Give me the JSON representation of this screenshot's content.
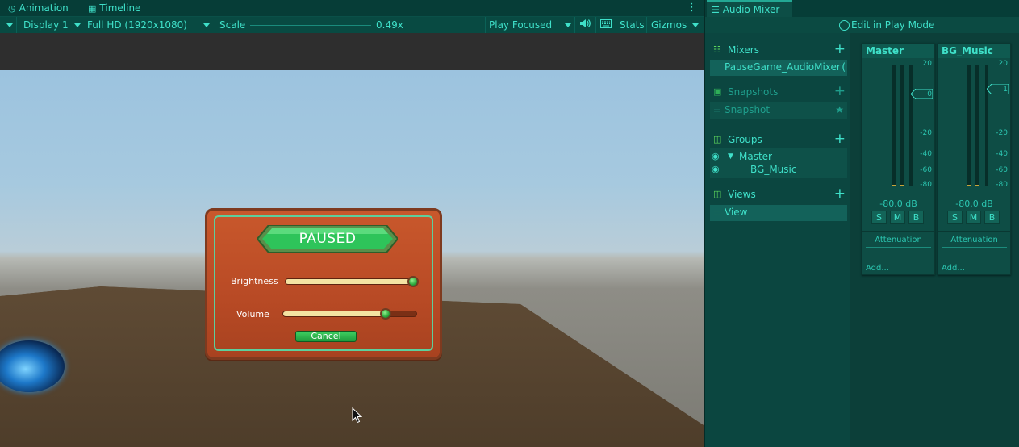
{
  "game": {
    "tabs": [
      {
        "label": "Animation",
        "icon": "clock-icon"
      },
      {
        "label": "Timeline",
        "icon": "film-icon"
      }
    ],
    "toolbar": {
      "display": "Display 1",
      "resolution": "Full HD (1920x1080)",
      "scale_label": "Scale",
      "scale_value": "0.49x",
      "scale_fraction": 0.0,
      "play_mode": "Play Focused",
      "stats": "Stats",
      "gizmos": "Gizmos"
    },
    "pause_menu": {
      "title": "PAUSED",
      "brightness_label": "Brightness",
      "brightness_value": 1.0,
      "volume_label": "Volume",
      "volume_value": 0.78,
      "cancel_label": "Cancel"
    }
  },
  "mixer": {
    "tab_label": "Audio Mixer",
    "edit_in_play_mode": "Edit in Play Mode",
    "sections": {
      "mixers": {
        "title": "Mixers",
        "items": [
          "PauseGame_AudioMixer"
        ]
      },
      "snapshots": {
        "title": "Snapshots",
        "items": [
          "Snapshot"
        ]
      },
      "groups": {
        "title": "Groups",
        "items": [
          "Master",
          "BG_Music"
        ]
      },
      "views": {
        "title": "Views",
        "items": [
          "View"
        ]
      }
    },
    "strips": [
      {
        "name": "Master",
        "db": "-80.0 dB",
        "fader_value": "0",
        "s": "S",
        "m": "M",
        "b": "B",
        "effect": "Attenuation",
        "add": "Add..."
      },
      {
        "name": "BG_Music",
        "db": "-80.0 dB",
        "fader_value": "1",
        "s": "S",
        "m": "M",
        "b": "B",
        "effect": "Attenuation",
        "add": "Add..."
      }
    ],
    "db_scale": [
      "20",
      "0",
      "-20",
      "-40",
      "-60",
      "-80"
    ]
  },
  "colors": {
    "accent": "#3fe0c9",
    "panel": "#0b3d37",
    "green_icon": "#5ed85c"
  }
}
